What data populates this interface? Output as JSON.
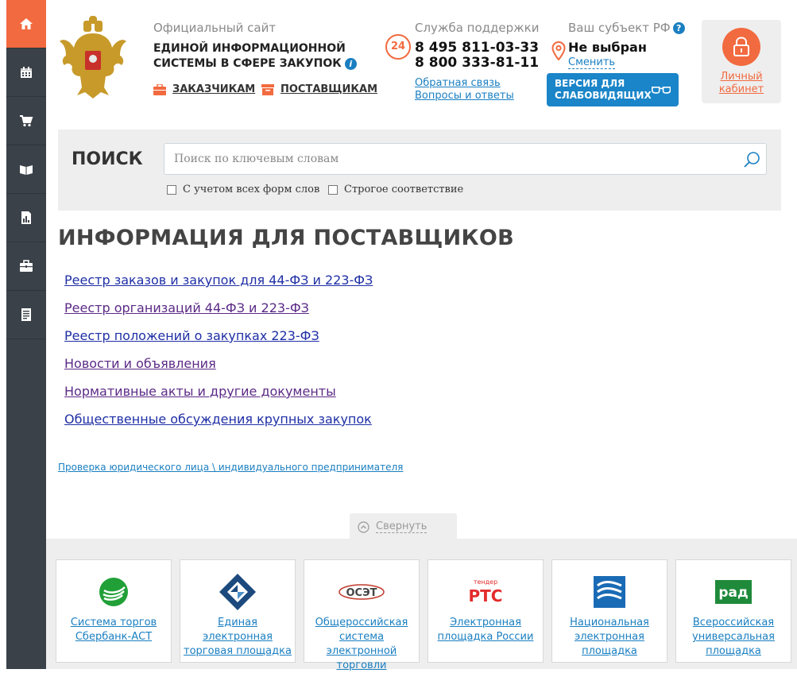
{
  "sidebar": {
    "items": [
      {
        "icon": "home-icon",
        "active": true
      },
      {
        "icon": "calendar-icon",
        "active": false
      },
      {
        "icon": "cart-icon",
        "active": false
      },
      {
        "icon": "book-icon",
        "active": false
      },
      {
        "icon": "report-icon",
        "active": false
      },
      {
        "icon": "briefcase-icon",
        "active": false
      },
      {
        "icon": "document-icon",
        "active": false
      }
    ]
  },
  "header": {
    "site_label": "Официальный сайт",
    "site_name_line1": "ЕДИНОЙ ИНФОРМАЦИОННОЙ",
    "site_name_line2": "СИСТЕМЫ В СФЕРЕ ЗАКУПОК",
    "customers_link": "ЗАКАЗЧИКАМ",
    "suppliers_link": "ПОСТАВЩИКАМ",
    "support_label": "Служба поддержки",
    "badge_24": "24",
    "phone1": "8 495 811-03-33",
    "phone2": "8 800 333-81-11",
    "feedback_link": "Обратная связь",
    "faq_link": "Вопросы и ответы",
    "region_label": "Ваш субъект РФ",
    "region_value": "Не выбран",
    "region_change": "Сменить",
    "vision_line1": "ВЕРСИЯ ДЛЯ",
    "vision_line2": "СЛАБОВИДЯЩИХ",
    "cabinet_line1": "Личный",
    "cabinet_line2": "кабинет"
  },
  "search": {
    "title": "ПОИСК",
    "placeholder": "Поиск по ключевым словам",
    "option1": "С учетом всех форм слов",
    "option2": "Строгое соответствие"
  },
  "main": {
    "title": "ИНФОРМАЦИЯ ДЛЯ ПОСТАВЩИКОВ",
    "links": [
      "Реестр заказов и закупок для 44-ФЗ и 223-ФЗ",
      "Реестр организаций 44-ФЗ и 223-ФЗ",
      "Реестр положений о закупках 223-ФЗ",
      "Новости и объявления",
      "Нормативные акты и другие документы",
      "Общественные обсуждения крупных закупок"
    ],
    "check_link": "Проверка юридического лица \\ индивидуального предпринимателя",
    "collapse_label": "Свернуть"
  },
  "platforms": [
    {
      "name": "Система торгов Сбербанк-АСТ",
      "logo_icon": "sberbank-logo-icon",
      "color": "#21a038"
    },
    {
      "name": "Единая электронная торговая площадка",
      "logo_icon": "roseltorg-logo-icon",
      "color": "#1c4a7e"
    },
    {
      "name": "Общероссийская система электронной торговли",
      "logo_icon": "zakazrf-logo-icon",
      "logo_text": "ОСЭТ",
      "color": "#c0392b"
    },
    {
      "name": "Электронная площадка России",
      "logo_icon": "rts-logo-icon",
      "logo_text": "РТС",
      "logo_small": "тендер",
      "color": "#e32b2b"
    },
    {
      "name": "Национальная электронная площадка",
      "logo_icon": "etp-logo-icon",
      "color": "#1a6bb5"
    },
    {
      "name": "Всероссийская универсальная площадка",
      "logo_icon": "rad-logo-icon",
      "logo_text": "рад",
      "color": "#1e8a3a"
    }
  ],
  "colors": {
    "accent": "#f26a3f",
    "link": "#1a7fc1",
    "sidebar": "#3a4149"
  }
}
